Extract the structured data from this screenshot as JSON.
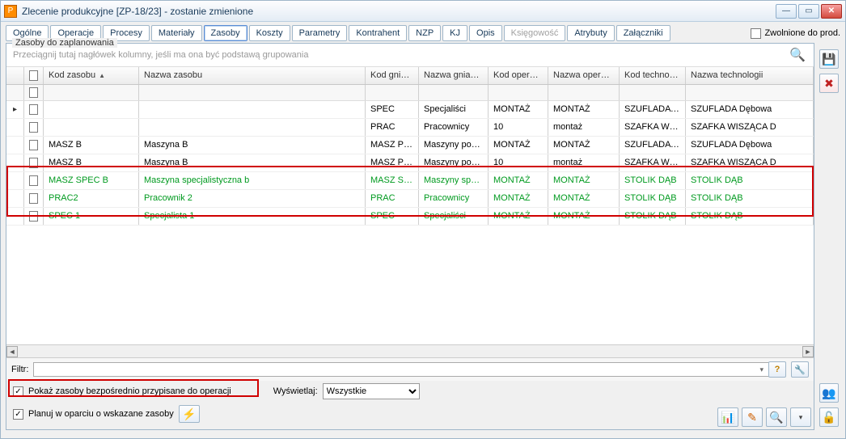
{
  "window": {
    "title": "Zlecenie produkcyjne  [ZP-18/23] - zostanie zmienione"
  },
  "tabs": [
    {
      "label": "Ogólne"
    },
    {
      "label": "Operacje"
    },
    {
      "label": "Procesy"
    },
    {
      "label": "Materiały"
    },
    {
      "label": "Zasoby",
      "active": true
    },
    {
      "label": "Koszty"
    },
    {
      "label": "Parametry"
    },
    {
      "label": "Kontrahent"
    },
    {
      "label": "NZP"
    },
    {
      "label": "KJ"
    },
    {
      "label": "Opis"
    },
    {
      "label": "Księgowość",
      "disabled": true
    },
    {
      "label": "Atrybuty"
    },
    {
      "label": "Załączniki"
    }
  ],
  "top_right_checkbox": "Zwolnione do prod.",
  "group_title": "Zasoby do zaplanowania",
  "group_hint": "Przeciągnij tutaj nagłówek kolumny, jeśli ma ona być podstawą grupowania",
  "columns": {
    "kod": "Kod zasobu",
    "nazwa": "Nazwa zasobu",
    "kodgn": "Kod gniazda",
    "nazgn": "Nazwa gniazda",
    "kodop": "Kod operacji",
    "nazop": "Nazwa operacji",
    "kodtech": "Kod technologii",
    "naztech": "Nazwa technologii"
  },
  "rows": [
    {
      "sel": "▸",
      "check": false,
      "kod": "",
      "nazwa": "",
      "kodgn": "SPEC",
      "nazgn": "Specjaliści",
      "kodop": "MONTAŻ",
      "nazop": "MONTAŻ",
      "kodtech": "SZUFLADA D...",
      "naztech": "SZUFLADA Dębowa",
      "cls": ""
    },
    {
      "sel": "",
      "check": false,
      "kod": "",
      "nazwa": "",
      "kodgn": "PRAC",
      "nazgn": "Pracownicy",
      "kodop": "10",
      "nazop": "montaż",
      "kodtech": "SZAFKA WIS...",
      "naztech": "SZAFKA WISZĄCA D",
      "cls": ""
    },
    {
      "sel": "",
      "check": false,
      "kod": "MASZ B",
      "nazwa": "Maszyna B",
      "kodgn": "MASZ POD",
      "nazgn": "Maszyny pod...",
      "kodop": "MONTAŻ",
      "nazop": "MONTAŻ",
      "kodtech": "SZUFLADA D...",
      "naztech": "SZUFLADA Dębowa",
      "cls": ""
    },
    {
      "sel": "",
      "check": false,
      "kod": "MASZ B",
      "nazwa": "Maszyna B",
      "kodgn": "MASZ POD",
      "nazgn": "Maszyny pod...",
      "kodop": "10",
      "nazop": "montaż",
      "kodtech": "SZAFKA WIS...",
      "naztech": "SZAFKA WISZĄCA D",
      "cls": ""
    },
    {
      "sel": "",
      "check": false,
      "kod": "MASZ SPEC B",
      "nazwa": "Maszyna specjalistyczna b",
      "kodgn": "MASZ SPEC",
      "nazgn": "Maszyny spe...",
      "kodop": "MONTAŻ",
      "nazop": "MONTAŻ",
      "kodtech": "STOLIK DĄB",
      "naztech": "STOLIK DĄB",
      "cls": "green"
    },
    {
      "sel": "",
      "check": false,
      "kod": "PRAC2",
      "nazwa": "Pracownik 2",
      "kodgn": "PRAC",
      "nazgn": "Pracownicy",
      "kodop": "MONTAŻ",
      "nazop": "MONTAŻ",
      "kodtech": "STOLIK DĄB",
      "naztech": "STOLIK DĄB",
      "cls": "green"
    },
    {
      "sel": "",
      "check": false,
      "kod": "SPEC 1",
      "nazwa": "Specjalista 1",
      "kodgn": "SPEC",
      "nazgn": "Specjaliści",
      "kodop": "MONTAŻ",
      "nazop": "MONTAŻ",
      "kodtech": "STOLIK DĄB",
      "naztech": "STOLIK DĄB",
      "cls": "green"
    }
  ],
  "filter_label": "Filtr:",
  "show_resources_label": "Pokaż zasoby bezpośrednio przypisane do operacji",
  "display_label": "Wyświetlaj:",
  "display_value": "Wszystkie",
  "plan_label": "Planuj w oparciu o wskazane zasoby"
}
